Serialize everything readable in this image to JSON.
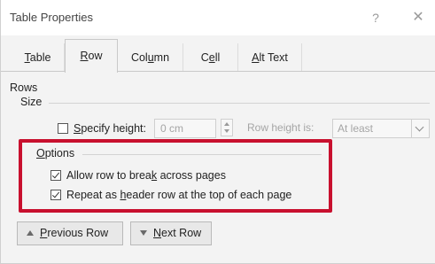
{
  "window": {
    "title": "Table Properties",
    "help_glyph": "?",
    "close_glyph": "✕"
  },
  "tabs": [
    {
      "pre": "",
      "key": "T",
      "post": "able",
      "active": false
    },
    {
      "pre": "",
      "key": "R",
      "post": "ow",
      "active": true
    },
    {
      "pre": "Col",
      "key": "u",
      "post": "mn",
      "active": false
    },
    {
      "pre": "C",
      "key": "e",
      "post": "ll",
      "active": false
    },
    {
      "pre": "",
      "key": "A",
      "post": "lt Text",
      "active": false
    }
  ],
  "rows": {
    "heading": "Rows",
    "size": {
      "heading": "Size",
      "specify_height": {
        "pre": "",
        "key": "S",
        "post": "pecify height:",
        "checked": false
      },
      "height_value": "0 cm",
      "row_height_is_label": "Row height is:",
      "row_height_is_value": "At least"
    }
  },
  "options": {
    "heading_pre": "",
    "heading_key": "O",
    "heading_post": "ptions",
    "allow_break": {
      "pre": "Allow row to brea",
      "key": "k",
      "post": " across pages",
      "checked": true
    },
    "repeat_header": {
      "pre": "Repeat as ",
      "key": "h",
      "post": "eader row at the top of each page",
      "checked": true
    }
  },
  "navigation": {
    "previous": {
      "pre": "",
      "key": "P",
      "post": "revious Row"
    },
    "next": {
      "pre": "",
      "key": "N",
      "post": "ext Row"
    }
  },
  "colors": {
    "highlight": "#c8102e",
    "dialog_bg": "#f3f3f3"
  },
  "icons": {
    "previous": "triangle-up-icon",
    "next": "triangle-down-icon",
    "dropdown": "chevron-down-icon"
  }
}
